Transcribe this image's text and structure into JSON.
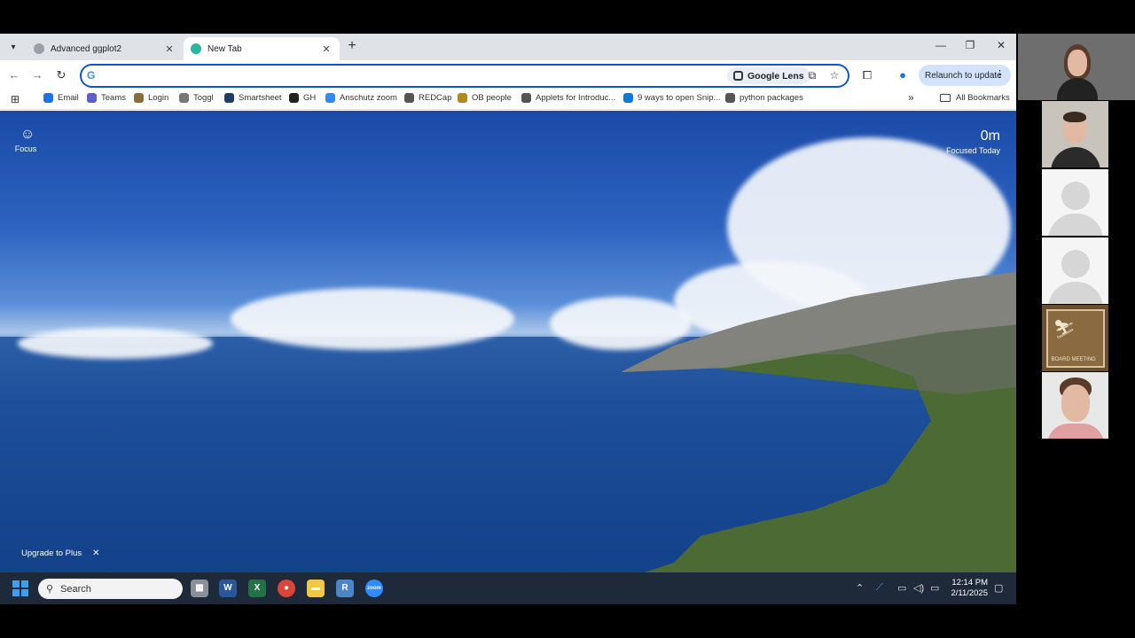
{
  "tabs": [
    {
      "title": "Advanced ggplot2",
      "active": false
    },
    {
      "title": "New Tab",
      "active": true
    }
  ],
  "omnibox": {
    "value": "",
    "placeholder": ""
  },
  "google_lens_label": "Google Lens",
  "relaunch_label": "Relaunch to update",
  "bookmarks": [
    {
      "label": "Email",
      "color": "#1a73e8"
    },
    {
      "label": "Teams",
      "color": "#5b5fc7"
    },
    {
      "label": "Login",
      "color": "#8a6d3b"
    },
    {
      "label": "Toggl",
      "color": "#777777"
    },
    {
      "label": "Smartsheet",
      "color": "#1f3d6b"
    },
    {
      "label": "GH",
      "color": "#222222"
    },
    {
      "label": "Anschutz zoom",
      "color": "#2d8cff"
    },
    {
      "label": "REDCap",
      "color": "#555555"
    },
    {
      "label": "OB people",
      "color": "#b08a1a"
    },
    {
      "label": "Applets for Introduc...",
      "color": "#555555"
    },
    {
      "label": "9 ways to open Snip...",
      "color": "#0a7bd6"
    },
    {
      "label": "python packages",
      "color": "#555555"
    }
  ],
  "all_bookmarks_label": "All Bookmarks",
  "focus": {
    "label": "Focus"
  },
  "focused_today": {
    "value": "0m",
    "label": "Focused Today"
  },
  "upgrade": {
    "label": "Upgrade to Plus"
  },
  "taskbar": {
    "search_label": "Search",
    "apps": [
      {
        "name": "file-manager",
        "glyph": "▦",
        "color": "#8a8f98"
      },
      {
        "name": "word",
        "glyph": "W",
        "color": "#2b579a"
      },
      {
        "name": "excel",
        "glyph": "X",
        "color": "#217346"
      },
      {
        "name": "chrome",
        "glyph": "●",
        "color": "#db4437"
      },
      {
        "name": "file-explorer",
        "glyph": "▬",
        "color": "#f2c744"
      },
      {
        "name": "r-app",
        "glyph": "R",
        "color": "#4a86c8"
      },
      {
        "name": "zoom",
        "glyph": "zoom",
        "color": "#2d8cff"
      }
    ],
    "time": "12:14 PM",
    "date": "2/11/2025"
  },
  "logo_text": "BOARD MEETING"
}
